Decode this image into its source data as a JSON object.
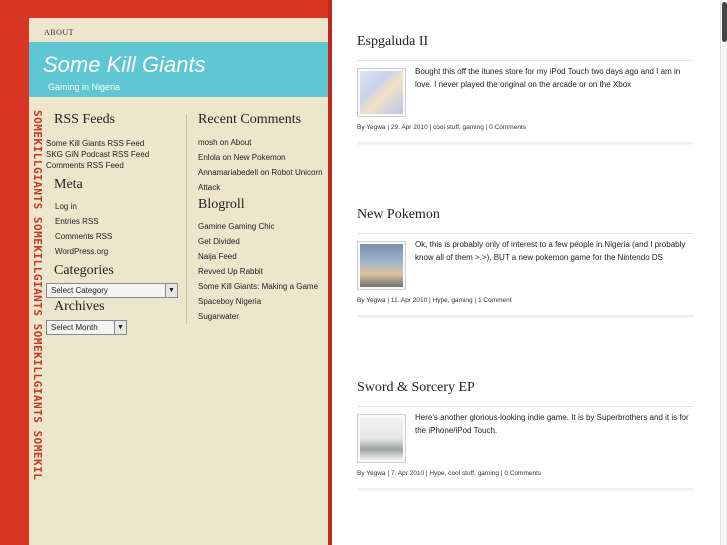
{
  "nav": {
    "about": "ABOUT"
  },
  "site": {
    "title": "Some Kill Giants",
    "tagline": "Gaming in Nigeria",
    "vertical_logo": "SOMEKILLGIANTS SOMEKILLGIANTS SOMEKILLGIANTS SOMEKILLGIANTS"
  },
  "sidebar_left": {
    "rss_title": "RSS Feeds",
    "rss_links": [
      "Some Kill Giants RSS Feed",
      "SKG GiN Podcast RSS Feed",
      "Comments RSS Feed"
    ],
    "meta_title": "Meta",
    "meta_links": [
      "Log in",
      "Entries RSS",
      "Comments RSS",
      "WordPress.org"
    ],
    "categories_title": "Categories",
    "categories_select": "Select Category",
    "archives_title": "Archives",
    "archives_select": "Select Month"
  },
  "sidebar_right": {
    "comments_title": "Recent Comments",
    "comments": [
      "mosh on About",
      "Enlola on New Pokemon",
      "Annamariabedell on Robot Unicorn",
      "Attack"
    ],
    "blogroll_title": "Blogroll",
    "blogroll": [
      "Gamine Gaming Chic",
      "Get Divided",
      "Naija Feed",
      "Revved Up Rabbit",
      "Some Kill Giants: Making a Game",
      "Spaceboy Nigeria",
      "Sugarwater"
    ]
  },
  "posts": [
    {
      "title": "Espgaluda II",
      "excerpt": "Bought this off the itunes store for my iPod Touch two days ago and I am in love. I never played the original on the arcade or on the Xbox",
      "meta": "By Yegwa | 29. Apr 2010 | cool stuff, gaming | 0 Comments"
    },
    {
      "title": "New Pokemon",
      "excerpt": "Ok, this is probably only of interest to a few people in Nigeria (and I probably know all of them >.>), BUT a new pokemon game for the Nintendo DS",
      "meta": "By Yegwa | 11. Apr 2010 | Hype, gaming | 1 Comment"
    },
    {
      "title": "Sword & Sorcery EP",
      "excerpt": "Here's another glorious-looking indie game. It is by Superbrothers and it is for the iPhone/iPod Touch.",
      "meta": "By Yegwa | 7. Apr 2010 | Hype, cool stuff, gaming | 0 Comments"
    }
  ],
  "colors": {
    "red": "#d93626",
    "cream": "#ede5cc",
    "cyan": "#5fc6d3"
  }
}
